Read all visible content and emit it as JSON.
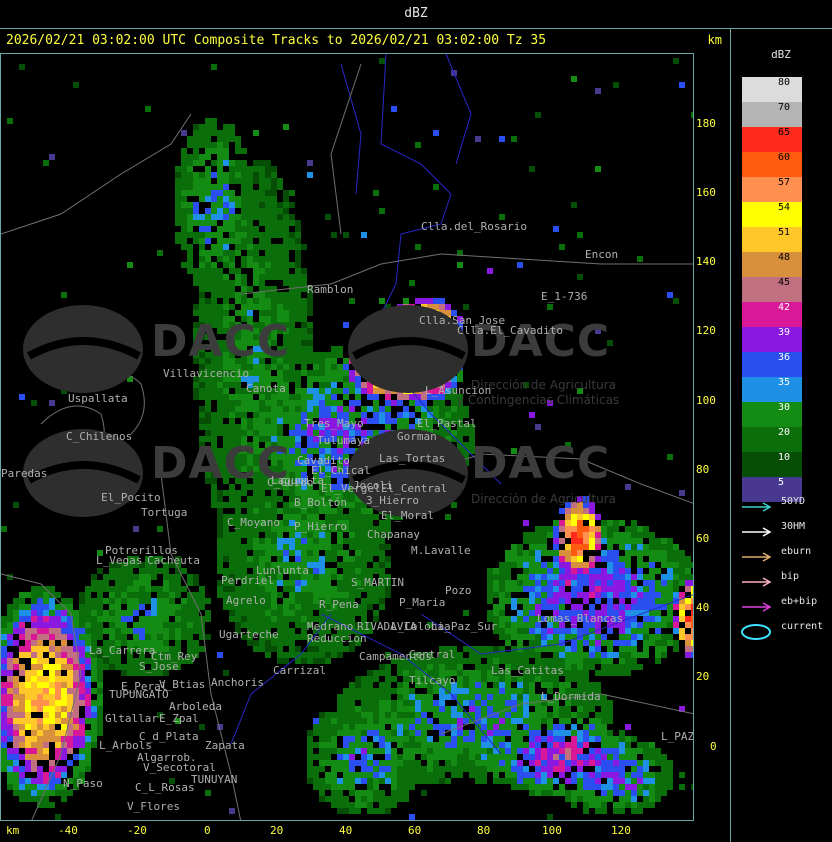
{
  "window_title": "dBZ",
  "header": {
    "title": "2026/02/21 03:02:00 UTC Composite Tracks to 2026/02/21 03:02:00 Tz 35",
    "km_label": "km"
  },
  "axes": {
    "y_ticks": [
      "180",
      "160",
      "140",
      "120",
      "100",
      "80",
      "60",
      "40",
      "20",
      "0"
    ],
    "x_ticks": [
      "-40",
      "-20",
      "0",
      "20",
      "40",
      "60",
      "80",
      "100",
      "120"
    ],
    "km_label": "km"
  },
  "colorbar": {
    "unit_label": "dBZ",
    "levels": [
      {
        "value": "80",
        "color": "#dcdcdc"
      },
      {
        "value": "70",
        "color": "#b4b4b4"
      },
      {
        "value": "65",
        "color": "#ff2a1c"
      },
      {
        "value": "60",
        "color": "#ff5a10"
      },
      {
        "value": "57",
        "color": "#ff9050"
      },
      {
        "value": "54",
        "color": "#ffff00"
      },
      {
        "value": "51",
        "color": "#ffc828"
      },
      {
        "value": "48",
        "color": "#d8903c"
      },
      {
        "value": "45",
        "color": "#c07080"
      },
      {
        "value": "42",
        "color": "#d81896"
      },
      {
        "value": "39",
        "color": "#8a18e0"
      },
      {
        "value": "36",
        "color": "#2a4ef0"
      },
      {
        "value": "35",
        "color": "#1e90e6"
      },
      {
        "value": "30",
        "color": "#148c14"
      },
      {
        "value": "20",
        "color": "#0a6e0a"
      },
      {
        "value": "10",
        "color": "#064e06"
      },
      {
        "value": "5",
        "color": "#483890"
      }
    ]
  },
  "track_legend": [
    {
      "label": "50YD",
      "color": "#40d0d0",
      "kind": "arrow"
    },
    {
      "label": "30HM",
      "color": "#ffffff",
      "kind": "arrow"
    },
    {
      "label": "eburn",
      "color": "#e0b070",
      "kind": "arrow"
    },
    {
      "label": "bip",
      "color": "#ffb0c0",
      "kind": "arrow"
    },
    {
      "label": "eb+bip",
      "color": "#e040e0",
      "kind": "arrow"
    },
    {
      "label": "current",
      "color": "#40e0ff",
      "kind": "ellipse"
    }
  ],
  "watermark": {
    "brand": "DACC",
    "subtitle_1": "Dirección de Agricultura",
    "subtitle_2": "y Contingencias Climáticas"
  },
  "places": [
    "Clla.del_Rosario",
    "Encon",
    "E_1-736",
    "Ramblon",
    "Clla.San_Jose",
    "Clla.El_Cavadito",
    "L_Asuncion",
    "Uspallata",
    "Villavicencio",
    "Canota",
    "C_Chilenos",
    "Tres_Mayo",
    "Tulumaya",
    "Gorman",
    "Las_Tortas",
    "Cavadito",
    "El_Chical",
    "El_Vergel",
    "El_Pastal",
    "Lagunita",
    "El_Pocito",
    "C_Guido",
    "B_Boltón",
    "3_Hierro",
    "El_Moral",
    "Jocoli",
    "El_Central",
    "Tortuga",
    "C_Moyano",
    "Chapanay",
    "M.Lavalle",
    "Potrerillos",
    "L_Vegas",
    "Cacheuta",
    "Perdriel",
    "Agrelo",
    "R_Pena",
    "S_MARTIN",
    "P_Maria",
    "Medrano",
    "Reduccion",
    "RIVADAVIA",
    "L_Colonia",
    "Ugarteche",
    "Carrizal",
    "Campamentos",
    "Central",
    "Lomas_Blancas",
    "La_Carrera",
    "Ctm_Rey",
    "S_Jose",
    "E_Peral",
    "V_Btias",
    "TUPUNGATO",
    "Anchoris",
    "Arboleda",
    "Las_Catitas",
    "L_Dormida",
    "Tilcayo",
    "Gltallar",
    "E_Zpal",
    "Zapata",
    "C_d_Plata",
    "L_Arbols",
    "Algarrob.",
    "V_Secotoral",
    "TUNUYAN",
    "C_L_Rosas",
    "V_Flores",
    "N_Paso",
    "L_PAZ",
    "Paredas",
    "Lunlunta",
    "P_Hierro",
    "La_Paz_Sur",
    "Pozo"
  ]
}
